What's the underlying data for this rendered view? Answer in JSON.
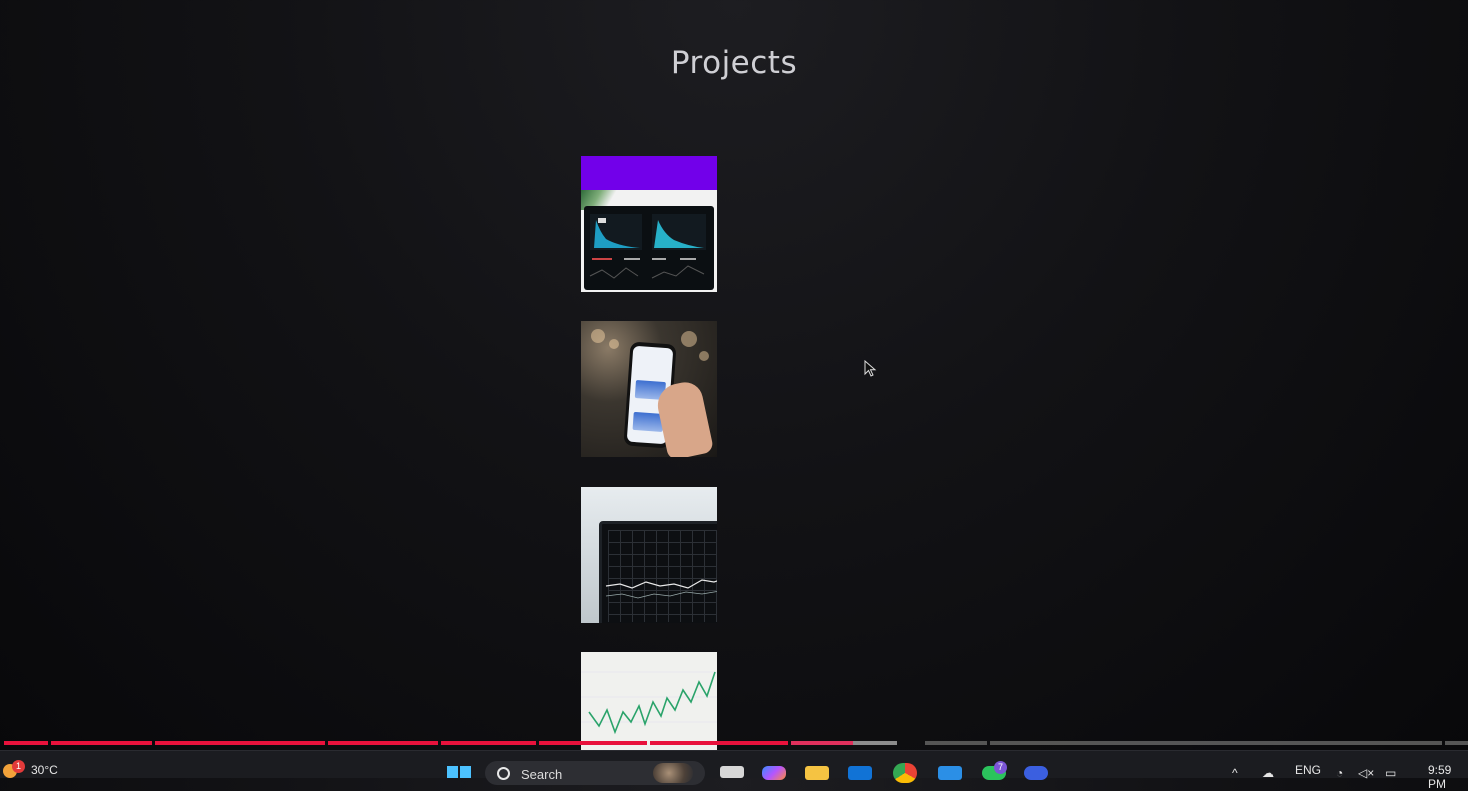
{
  "page": {
    "title": "Projects",
    "projects": [
      {
        "icon": "analytics-dashboard-thumbnail"
      },
      {
        "icon": "mobile-app-thumbnail"
      },
      {
        "icon": "laptop-chart-thumbnail"
      },
      {
        "icon": "growth-chart-thumbnail"
      }
    ]
  },
  "video": {
    "progress_played_fraction": 0.58
  },
  "taskbar": {
    "weather": {
      "temperature": "30°C",
      "badge": "1",
      "icon": "weather-sun-icon"
    },
    "search": {
      "label": "Search"
    },
    "apps": [
      {
        "name": "start-menu-icon"
      },
      {
        "name": "task-view-icon"
      },
      {
        "name": "copilot-icon"
      },
      {
        "name": "file-explorer-icon"
      },
      {
        "name": "outlook-icon"
      },
      {
        "name": "chrome-icon"
      },
      {
        "name": "vscode-icon"
      },
      {
        "name": "whatsapp-icon",
        "badge": "7"
      },
      {
        "name": "settings-app-icon"
      }
    ],
    "tray": {
      "language": "ENG",
      "time": "9:59 PM"
    }
  },
  "colors": {
    "accent_purple": "#7200ea",
    "progress_red": "#e8123c",
    "background": "#0d0d10"
  }
}
